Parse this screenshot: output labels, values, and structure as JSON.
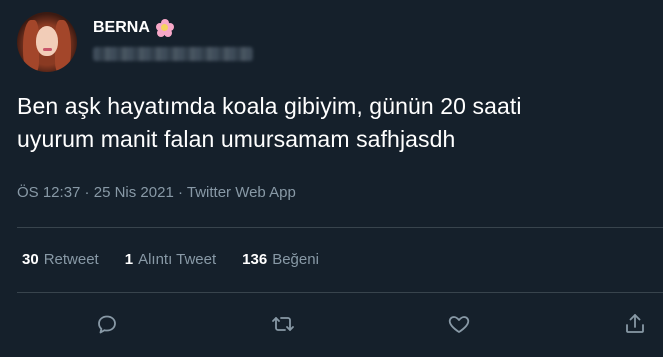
{
  "user": {
    "display_name": "BERNA",
    "emoji_icon": "cherry-blossom-icon"
  },
  "tweet": {
    "text": "Ben aşk hayatımda koala gibiyim, günün 20 saati\nuyurum manit falan umursamam safhjasdh"
  },
  "meta": {
    "time": "ÖS 12:37",
    "separator": " · ",
    "date": "25 Nis 2021",
    "source": "Twitter Web App"
  },
  "stats": [
    {
      "count": "30",
      "label": "Retweet"
    },
    {
      "count": "1",
      "label": "Alıntı Tweet"
    },
    {
      "count": "136",
      "label": "Beğeni"
    }
  ],
  "actions": [
    "reply-icon",
    "retweet-icon",
    "like-icon",
    "share-icon"
  ],
  "colors": {
    "background": "#15202b",
    "secondary_text": "#8899a6",
    "divider": "#38444d"
  }
}
